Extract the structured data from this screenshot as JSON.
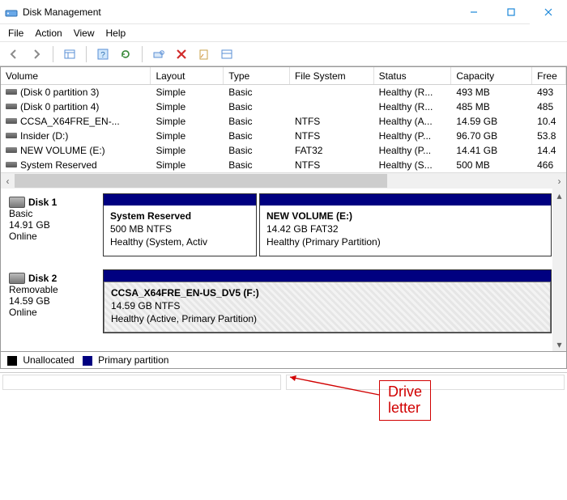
{
  "window": {
    "title": "Disk Management"
  },
  "menubar": [
    "File",
    "Action",
    "View",
    "Help"
  ],
  "columns": {
    "volume": "Volume",
    "layout": "Layout",
    "type": "Type",
    "fs": "File System",
    "status": "Status",
    "capacity": "Capacity",
    "free": "Free"
  },
  "volumes": [
    {
      "name": "(Disk 0 partition 3)",
      "layout": "Simple",
      "type": "Basic",
      "fs": "",
      "status": "Healthy (R...",
      "capacity": "493 MB",
      "free": "493"
    },
    {
      "name": "(Disk 0 partition 4)",
      "layout": "Simple",
      "type": "Basic",
      "fs": "",
      "status": "Healthy (R...",
      "capacity": "485 MB",
      "free": "485"
    },
    {
      "name": "CCSA_X64FRE_EN-...",
      "layout": "Simple",
      "type": "Basic",
      "fs": "NTFS",
      "status": "Healthy (A...",
      "capacity": "14.59 GB",
      "free": "10.4"
    },
    {
      "name": "Insider (D:)",
      "layout": "Simple",
      "type": "Basic",
      "fs": "NTFS",
      "status": "Healthy (P...",
      "capacity": "96.70 GB",
      "free": "53.8"
    },
    {
      "name": "NEW VOLUME (E:)",
      "layout": "Simple",
      "type": "Basic",
      "fs": "FAT32",
      "status": "Healthy (P...",
      "capacity": "14.41 GB",
      "free": "14.4"
    },
    {
      "name": "System Reserved",
      "layout": "Simple",
      "type": "Basic",
      "fs": "NTFS",
      "status": "Healthy (S...",
      "capacity": "500 MB",
      "free": "466"
    }
  ],
  "disks": [
    {
      "label": "Disk 1",
      "kind": "Basic",
      "size": "14.91 GB",
      "state": "Online",
      "partitions": [
        {
          "name": "System Reserved",
          "size": "500 MB NTFS",
          "status": "Healthy (System, Activ",
          "selected": false
        },
        {
          "name": "NEW VOLUME  (E:)",
          "size": "14.42 GB FAT32",
          "status": "Healthy (Primary Partition)",
          "selected": false
        }
      ]
    },
    {
      "label": "Disk 2",
      "kind": "Removable",
      "size": "14.59 GB",
      "state": "Online",
      "partitions": [
        {
          "name": "CCSA_X64FRE_EN-US_DV5  (F:)",
          "size": "14.59 GB NTFS",
          "status": "Healthy (Active, Primary Partition)",
          "selected": true
        }
      ]
    }
  ],
  "legend": {
    "unalloc": "Unallocated",
    "primary": "Primary partition",
    "colors": {
      "unalloc": "#000000",
      "primary": "#000080"
    }
  },
  "annotation": {
    "text": "Drive letter"
  }
}
